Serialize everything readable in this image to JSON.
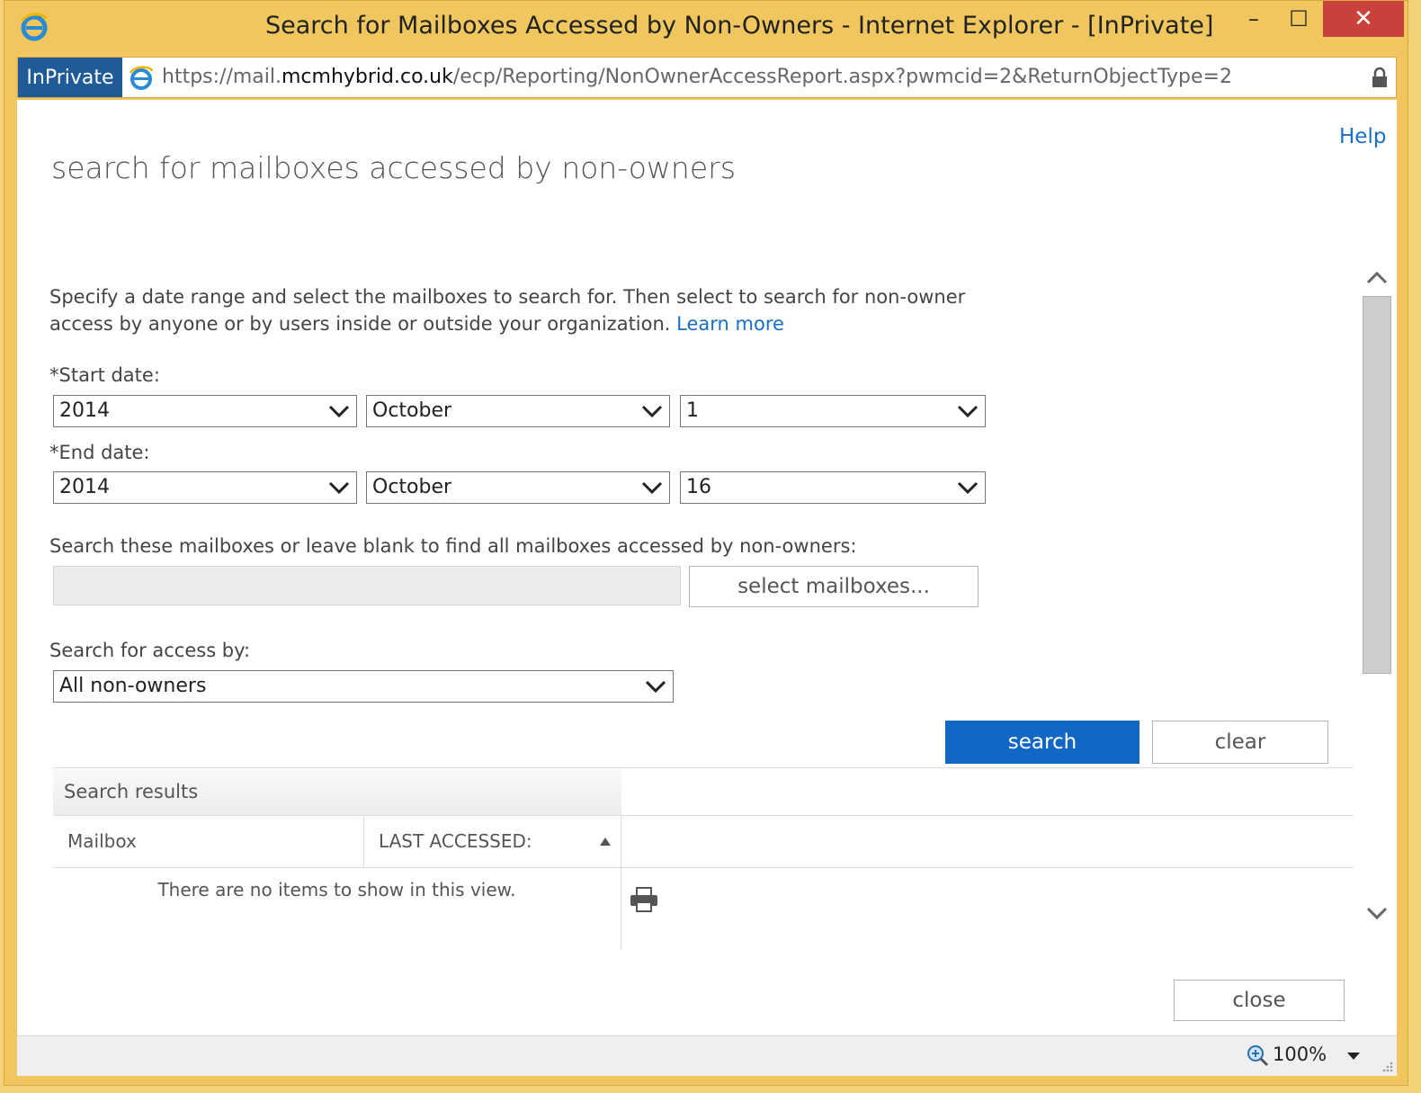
{
  "window": {
    "title": "Search for Mailboxes Accessed by Non-Owners - Internet Explorer - [InPrivate]",
    "minimize": "–",
    "maximize": "☐",
    "close": "✕"
  },
  "addressbar": {
    "inprivate_label": "InPrivate",
    "url_scheme": "https://mail.",
    "url_domain": "mcmhybrid.co.uk",
    "url_path": "/ecp/Reporting/NonOwnerAccessReport.aspx?pwmcid=2&ReturnObjectType=2"
  },
  "page": {
    "help_label": "Help",
    "title": "search for mailboxes accessed by non-owners",
    "description": "Specify a date range and select the mailboxes to search for. Then select to search for non-owner access by anyone or by users inside or outside your organization.",
    "learn_more": "Learn more"
  },
  "start_date": {
    "label": "*Start date:",
    "year": "2014",
    "month": "October",
    "day": "1"
  },
  "end_date": {
    "label": "*End date:",
    "year": "2014",
    "month": "October",
    "day": "16"
  },
  "mailboxes": {
    "label": "Search these mailboxes or leave blank to find all mailboxes accessed by non-owners:",
    "value": "",
    "select_button": "select mailboxes..."
  },
  "access_by": {
    "label": "Search for access by:",
    "value": "All non-owners"
  },
  "actions": {
    "search": "search",
    "clear": "clear",
    "close": "close"
  },
  "results": {
    "header": "Search results",
    "columns": [
      "Mailbox",
      "LAST ACCESSED:"
    ],
    "empty_message": "There are no items to show in this view."
  },
  "status": {
    "zoom": "100%"
  },
  "colors": {
    "accent": "#1367c4",
    "link": "#1a6fc4",
    "window_frame": "#f0c75e",
    "close_button": "#c9413a",
    "inprivate_badge": "#1f5b97"
  },
  "icons": [
    "ie-logo-icon",
    "lock-icon",
    "chevron-down-icon",
    "sort-ascending-icon",
    "printer-icon",
    "scroll-up-icon",
    "scroll-down-icon",
    "zoom-icon"
  ]
}
